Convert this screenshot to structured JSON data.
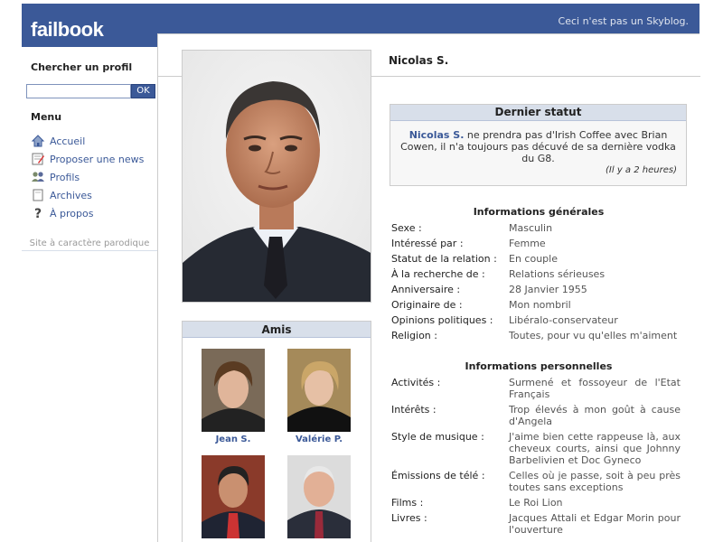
{
  "header": {
    "logo": "failbook",
    "tagline": "Ceci n'est pas un Skyblog."
  },
  "sidebar": {
    "search_title": "Chercher un profil",
    "search": {
      "value": "",
      "placeholder": ""
    },
    "ok_label": "OK",
    "menu_title": "Menu",
    "items": [
      {
        "label": "Accueil",
        "icon": "home-icon"
      },
      {
        "label": "Proposer une news",
        "icon": "compose-icon"
      },
      {
        "label": "Profils",
        "icon": "users-icon"
      },
      {
        "label": "Archives",
        "icon": "archive-icon"
      },
      {
        "label": "À propos",
        "icon": "help-icon"
      }
    ],
    "footer": "Site à caractère parodique"
  },
  "profile": {
    "name": "Nicolas S."
  },
  "status": {
    "title": "Dernier statut",
    "author": "Nicolas S.",
    "text": " ne prendra pas d'Irish Coffee avec Brian Cowen, il n'a toujours pas décuvé de sa dernière vodka du G8.",
    "time": "(Il y a 2 heures)"
  },
  "friends": {
    "title": "Amis",
    "items": [
      {
        "name": "Jean S."
      },
      {
        "name": "Valérie P."
      },
      {
        "name": ""
      },
      {
        "name": ""
      }
    ]
  },
  "general_info": {
    "title": "Informations générales",
    "rows": [
      {
        "key": "Sexe :",
        "value": "Masculin"
      },
      {
        "key": "Intéressé par :",
        "value": "Femme"
      },
      {
        "key": "Statut de la relation :",
        "value": "En couple"
      },
      {
        "key": "À la recherche de :",
        "value": "Relations sérieuses"
      },
      {
        "key": "Anniversaire :",
        "value": "28 Janvier 1955"
      },
      {
        "key": "Originaire de :",
        "value": "Mon nombril"
      },
      {
        "key": "Opinions politiques :",
        "value": "Libéralo-conservateur"
      },
      {
        "key": "Religion :",
        "value": "Toutes, pour vu qu'elles m'aiment"
      }
    ]
  },
  "personal_info": {
    "title": "Informations personnelles",
    "rows": [
      {
        "key": "Activités :",
        "value": "Surmené et fossoyeur de l'Etat Français"
      },
      {
        "key": "Intérêts :",
        "value": "Trop élevés à mon goût à cause d'Angela"
      },
      {
        "key": "Style de musique :",
        "value": "J'aime bien cette rappeuse là, aux cheveux courts, ainsi que Johnny Barbelivien et Doc Gyneco"
      },
      {
        "key": "Émissions de télé :",
        "value": "Celles où je passe, soit à peu près toutes sans exceptions"
      },
      {
        "key": "Films :",
        "value": "Le Roi Lion"
      },
      {
        "key": "Livres :",
        "value": "Jacques Attali et Edgar Morin pour l'ouverture"
      }
    ]
  },
  "colors": {
    "brand": "#3b5998",
    "box_header": "#d8dfea"
  }
}
